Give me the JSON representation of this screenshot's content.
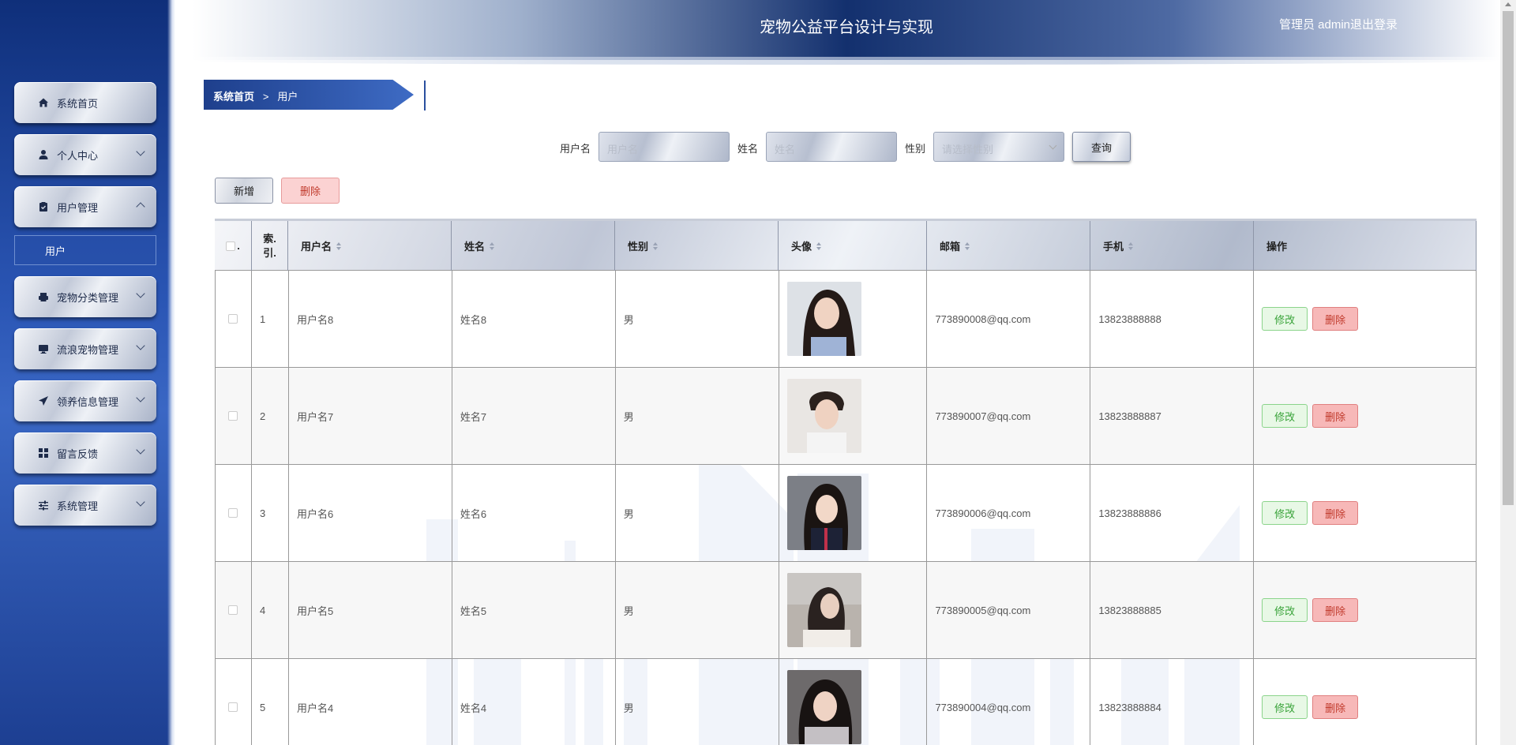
{
  "header": {
    "title": "宠物公益平台设计与实现",
    "user": "管理员 admin",
    "logout": "退出登录"
  },
  "sidebar": {
    "items": [
      {
        "label": "系统首页",
        "icon": "home-icon",
        "expandable": false
      },
      {
        "label": "个人中心",
        "icon": "person-icon",
        "expandable": true,
        "expanded": false
      },
      {
        "label": "用户管理",
        "icon": "clipboard-icon",
        "expandable": true,
        "expanded": true,
        "children": [
          "用户"
        ]
      },
      {
        "label": "宠物分类管理",
        "icon": "printer-icon",
        "expandable": true,
        "expanded": false
      },
      {
        "label": "流浪宠物管理",
        "icon": "monitor-icon",
        "expandable": true,
        "expanded": false
      },
      {
        "label": "领养信息管理",
        "icon": "paper-plane-icon",
        "expandable": true,
        "expanded": false
      },
      {
        "label": "留言反馈",
        "icon": "grid-icon",
        "expandable": true,
        "expanded": false
      },
      {
        "label": "系统管理",
        "icon": "sliders-icon",
        "expandable": true,
        "expanded": false
      }
    ]
  },
  "breadcrumb": {
    "home": "系统首页",
    "separator": ">",
    "current": "用户"
  },
  "search": {
    "username_label": "用户名",
    "username_placeholder": "用户名",
    "name_label": "姓名",
    "name_placeholder": "姓名",
    "gender_label": "性别",
    "gender_placeholder": "请选择性别",
    "query_button": "查询"
  },
  "actions": {
    "add": "新增",
    "delete": "删除"
  },
  "table": {
    "columns": [
      "索引",
      "用户名",
      "姓名",
      "性别",
      "头像",
      "邮箱",
      "手机",
      "操作"
    ],
    "index_header_line1": "索.",
    "index_header_line2": "引.",
    "rows": [
      {
        "index": "1",
        "username": "用户名8",
        "name": "姓名8",
        "gender": "男",
        "email": "773890008@qq.com",
        "phone": "13823888888"
      },
      {
        "index": "2",
        "username": "用户名7",
        "name": "姓名7",
        "gender": "男",
        "email": "773890007@qq.com",
        "phone": "13823888887"
      },
      {
        "index": "3",
        "username": "用户名6",
        "name": "姓名6",
        "gender": "男",
        "email": "773890006@qq.com",
        "phone": "13823888886"
      },
      {
        "index": "4",
        "username": "用户名5",
        "name": "姓名5",
        "gender": "男",
        "email": "773890005@qq.com",
        "phone": "13823888885"
      },
      {
        "index": "5",
        "username": "用户名4",
        "name": "姓名4",
        "gender": "男",
        "email": "773890004@qq.com",
        "phone": "13823888884"
      }
    ],
    "edit_label": "修改",
    "delete_label": "删除"
  },
  "colors": {
    "sidebar_dark": "#0f2f7a",
    "sidebar_light": "#3a67c4",
    "header_center": "#13306e",
    "edit_green": "#39a339",
    "delete_red": "#c0392b"
  }
}
